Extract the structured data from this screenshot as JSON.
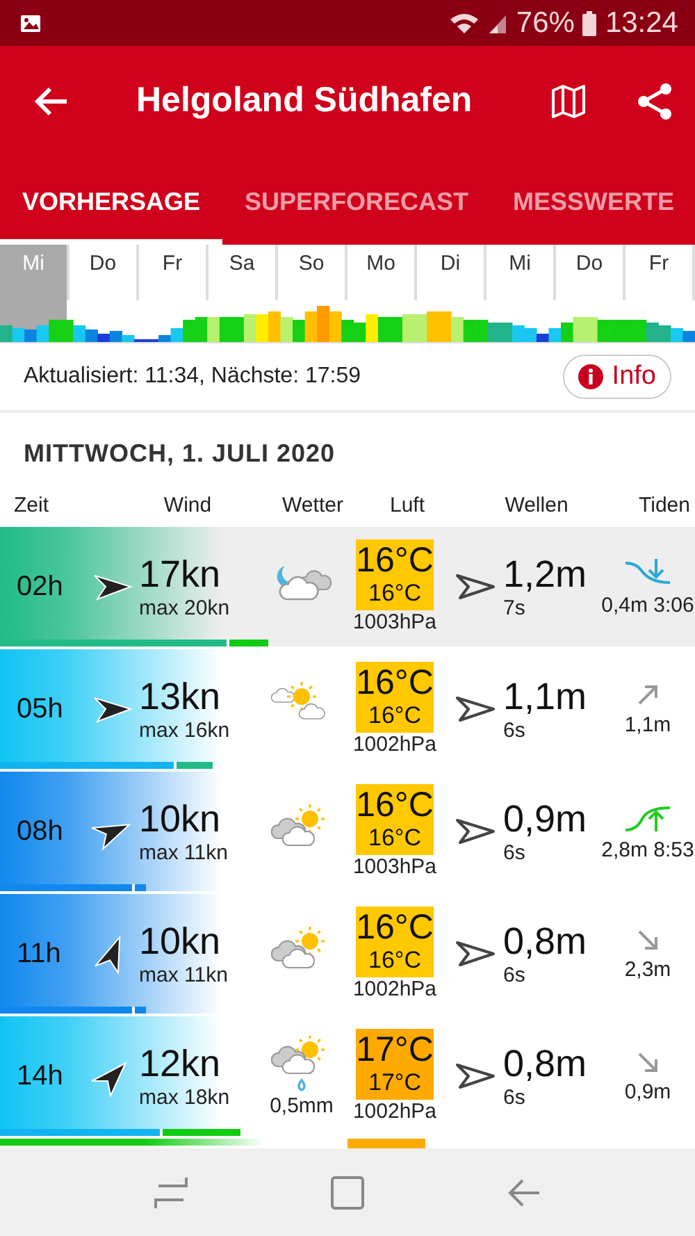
{
  "status_bar": {
    "battery": "76%",
    "time": "13:24"
  },
  "header": {
    "title": "Helgoland Südhafen"
  },
  "tabs": [
    {
      "label": "VORHERSAGE",
      "selected": true
    },
    {
      "label": "SUPERFORECAST",
      "selected": false
    },
    {
      "label": "MESSWERTE",
      "selected": false
    }
  ],
  "days": [
    {
      "label": "Mi",
      "selected": true
    },
    {
      "label": "Do",
      "selected": false
    },
    {
      "label": "Fr",
      "selected": false
    },
    {
      "label": "Sa",
      "selected": false
    },
    {
      "label": "So",
      "selected": false
    },
    {
      "label": "Mo",
      "selected": false
    },
    {
      "label": "Di",
      "selected": false
    },
    {
      "label": "Mi",
      "selected": false
    },
    {
      "label": "Do",
      "selected": false
    },
    {
      "label": "Fr",
      "selected": false
    }
  ],
  "update": {
    "text": "Aktualisiert: 11:34, Nächste: 17:59",
    "button": "Info"
  },
  "date_heading": "MITTWOCH, 1. JULI 2020",
  "columns": [
    "Zeit",
    "Wind",
    "Wetter",
    "Luft",
    "Wellen",
    "Tiden"
  ],
  "rows": [
    {
      "time": "02h",
      "selected": true,
      "wind": {
        "color": "#22bb88",
        "kind": "west",
        "speed": "17kn",
        "gust": "max 20kn"
      },
      "wind_bar": {
        "level": 0.325,
        "color": "#22bb88"
      },
      "gust_bar": {
        "level": 0.385,
        "color": "#11cc11"
      },
      "weather": {
        "kind": "moon-cloud"
      },
      "temp": {
        "color": "#ffc800",
        "air": "16°C",
        "water": "16°C"
      },
      "pressure": "1003hPa",
      "wave": {
        "kind": "west",
        "height": "1,2m",
        "period": "7s"
      },
      "tide": {
        "kind": "low",
        "text": "0,4m 3:06"
      }
    },
    {
      "time": "05h",
      "selected": false,
      "wind": {
        "color": "#11c4f4",
        "kind": "west",
        "speed": "13kn",
        "gust": "max 16kn"
      },
      "wind_bar": {
        "level": 0.25,
        "color": "#11b4f0"
      },
      "gust_bar": {
        "level": 0.305,
        "color": "#22bb88"
      },
      "weather": {
        "kind": "sun-cloud"
      },
      "temp": {
        "color": "#ffc800",
        "air": "16°C",
        "water": "16°C"
      },
      "pressure": "1002hPa",
      "wave": {
        "kind": "west",
        "height": "1,1m",
        "period": "6s"
      },
      "tide": {
        "kind": "rising",
        "text": "1,1m"
      }
    },
    {
      "time": "08h",
      "selected": false,
      "wind": {
        "color": "#1188ee",
        "kind": "west-southwest",
        "speed": "10kn",
        "gust": "max 11kn"
      },
      "wind_bar": {
        "level": 0.19,
        "color": "#1188ee"
      },
      "gust_bar": {
        "level": 0.21,
        "color": "#1188ee"
      },
      "weather": {
        "kind": "cloud-sun"
      },
      "temp": {
        "color": "#ffc800",
        "air": "16°C",
        "water": "16°C"
      },
      "pressure": "1003hPa",
      "wave": {
        "kind": "west",
        "height": "0,9m",
        "period": "6s"
      },
      "tide": {
        "kind": "high",
        "text": "2,8m 8:53"
      }
    },
    {
      "time": "11h",
      "selected": false,
      "wind": {
        "color": "#1188ee",
        "kind": "south-southwest",
        "speed": "10kn",
        "gust": "max 11kn"
      },
      "wind_bar": {
        "level": 0.19,
        "color": "#1188ee"
      },
      "gust_bar": {
        "level": 0.21,
        "color": "#1188ee"
      },
      "weather": {
        "kind": "cloud-sun"
      },
      "temp": {
        "color": "#ffc800",
        "air": "16°C",
        "water": "16°C"
      },
      "pressure": "1002hPa",
      "wave": {
        "kind": "west",
        "height": "0,8m",
        "period": "6s"
      },
      "tide": {
        "kind": "falling",
        "text": "2,3m"
      }
    },
    {
      "time": "14h",
      "selected": false,
      "wind": {
        "color": "#11c4f4",
        "kind": "southwest",
        "speed": "12kn",
        "gust": "max 18kn"
      },
      "wind_bar": {
        "level": 0.23,
        "color": "#11b4f0"
      },
      "gust_bar": {
        "level": 0.345,
        "color": "#11cc11"
      },
      "weather": {
        "kind": "cloud-sun-rain",
        "rain": "0,5mm"
      },
      "temp": {
        "color": "#ffaa00",
        "air": "17°C",
        "water": "17°C"
      },
      "pressure": "1002hPa",
      "wave": {
        "kind": "west",
        "height": "0,8m",
        "period": "6s"
      },
      "tide": {
        "kind": "falling",
        "text": "0,9m"
      }
    }
  ],
  "next_row": {
    "wind": {
      "color": "#11cc11"
    },
    "temp": {
      "color": "#ffaa00"
    }
  }
}
